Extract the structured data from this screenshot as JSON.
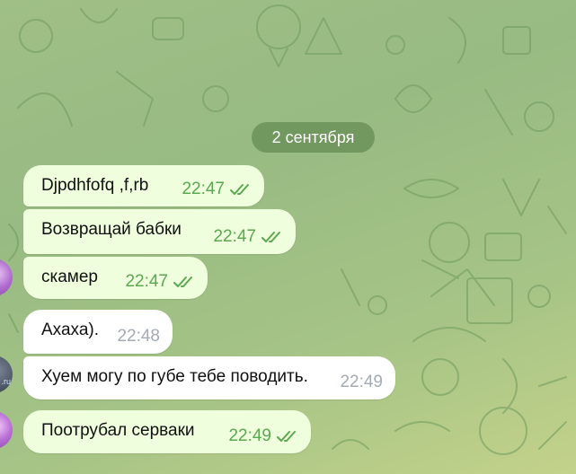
{
  "chat": {
    "date_separator": "2 сентября",
    "messages": [
      {
        "text": "Djpdhfofq ,f,rb",
        "time": "22:47",
        "direction": "outgoing",
        "status": "read"
      },
      {
        "text": "Возвращай бабки",
        "time": "22:47",
        "direction": "outgoing",
        "status": "read"
      },
      {
        "text": "скамер",
        "time": "22:47",
        "direction": "outgoing",
        "status": "read"
      },
      {
        "text": "Ахаха).",
        "time": "22:48",
        "direction": "incoming"
      },
      {
        "text": "Хуем могу по губе тебе поводить.",
        "time": "22:49",
        "direction": "incoming"
      },
      {
        "text": "Поотрубал серваки",
        "time": "22:49",
        "direction": "outgoing",
        "status": "read"
      }
    ]
  },
  "theme": {
    "wallpaper_color": "#9fbf86",
    "outgoing_bubble_color": "#effedd",
    "incoming_bubble_color": "#ffffff",
    "read_check_color": "#5aa84f",
    "incoming_time_color": "#a3abb5",
    "date_pill_color": "#628a52"
  },
  "icons": {
    "read_status": "double-check-icon"
  }
}
